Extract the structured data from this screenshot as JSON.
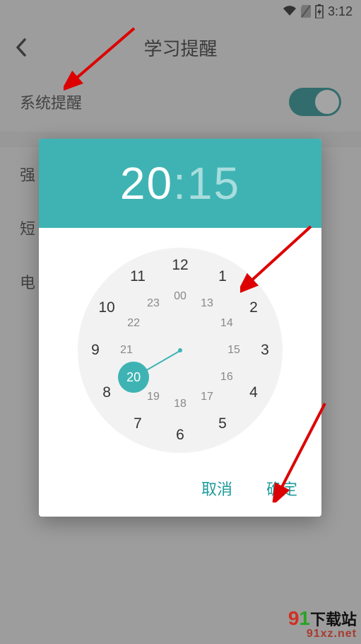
{
  "status": {
    "time": "3:12"
  },
  "header": {
    "title": "学习提醒"
  },
  "settings": {
    "system_reminder_label": "系统提醒",
    "row2_label": "强",
    "row3_label": "短",
    "row4_label": "电"
  },
  "timepicker": {
    "hour": "20",
    "minute": "15",
    "outer": [
      "12",
      "1",
      "2",
      "3",
      "4",
      "5",
      "6",
      "7",
      "8",
      "9",
      "10",
      "11"
    ],
    "inner": [
      "00",
      "13",
      "14",
      "15",
      "16",
      "17",
      "18",
      "19",
      "20",
      "21",
      "22",
      "23"
    ],
    "selected_inner": "20",
    "cancel": "取消",
    "ok": "确定"
  },
  "watermark": {
    "nine": "9",
    "one": "1",
    "cn": "下载站",
    "url": "91xz.net"
  }
}
